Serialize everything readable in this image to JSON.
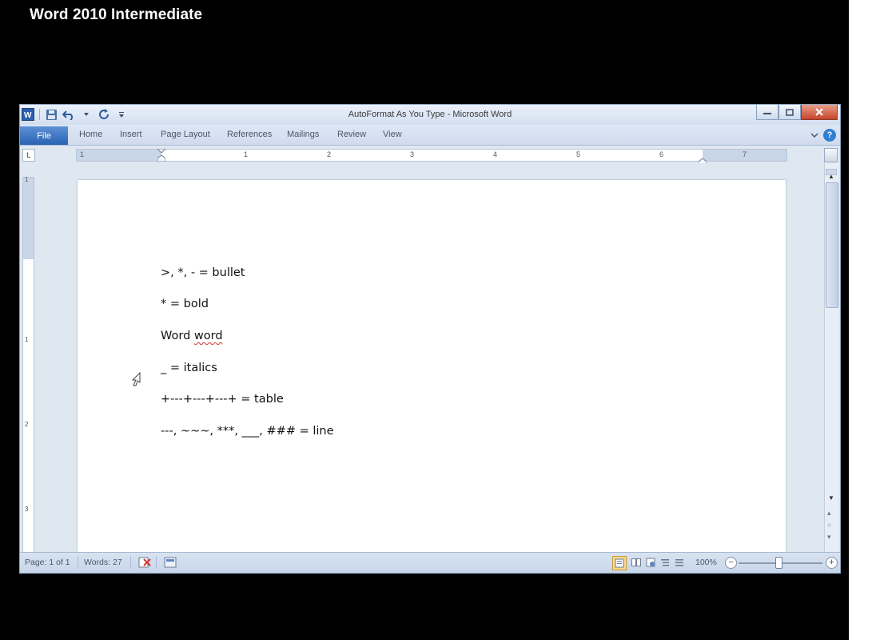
{
  "video": {
    "title": "Word 2010 Intermediate"
  },
  "window": {
    "title": "AutoFormat As You Type - Microsoft Word"
  },
  "ribbon": {
    "tabs": [
      "File",
      "Home",
      "Insert",
      "Page Layout",
      "References",
      "Mailings",
      "Review",
      "View"
    ]
  },
  "ruler": {
    "corner": "L",
    "numbers": [
      "1",
      "1",
      "2",
      "3",
      "4",
      "5",
      "6",
      "7"
    ],
    "vnumbers": [
      "1",
      "1",
      "2",
      "3"
    ]
  },
  "document": {
    "lines": [
      {
        "text": ">, *, - = bullet"
      },
      {
        "text": "* = bold"
      },
      {
        "prefix": "Word ",
        "squiggle": "word"
      },
      {
        "text": "_ = italics"
      },
      {
        "text": "+---+---+---+ = table"
      },
      {
        "text": "---, ~~~, ***, ___, ### = line"
      }
    ]
  },
  "statusbar": {
    "page": "Page: 1 of 1",
    "words": "Words: 27",
    "zoom": "100%",
    "zoom_out": "−",
    "zoom_in": "+"
  },
  "colors": {
    "file_tab": "#2a63b2",
    "close_button": "#c7442a",
    "spelling_error": "#d2342c"
  }
}
